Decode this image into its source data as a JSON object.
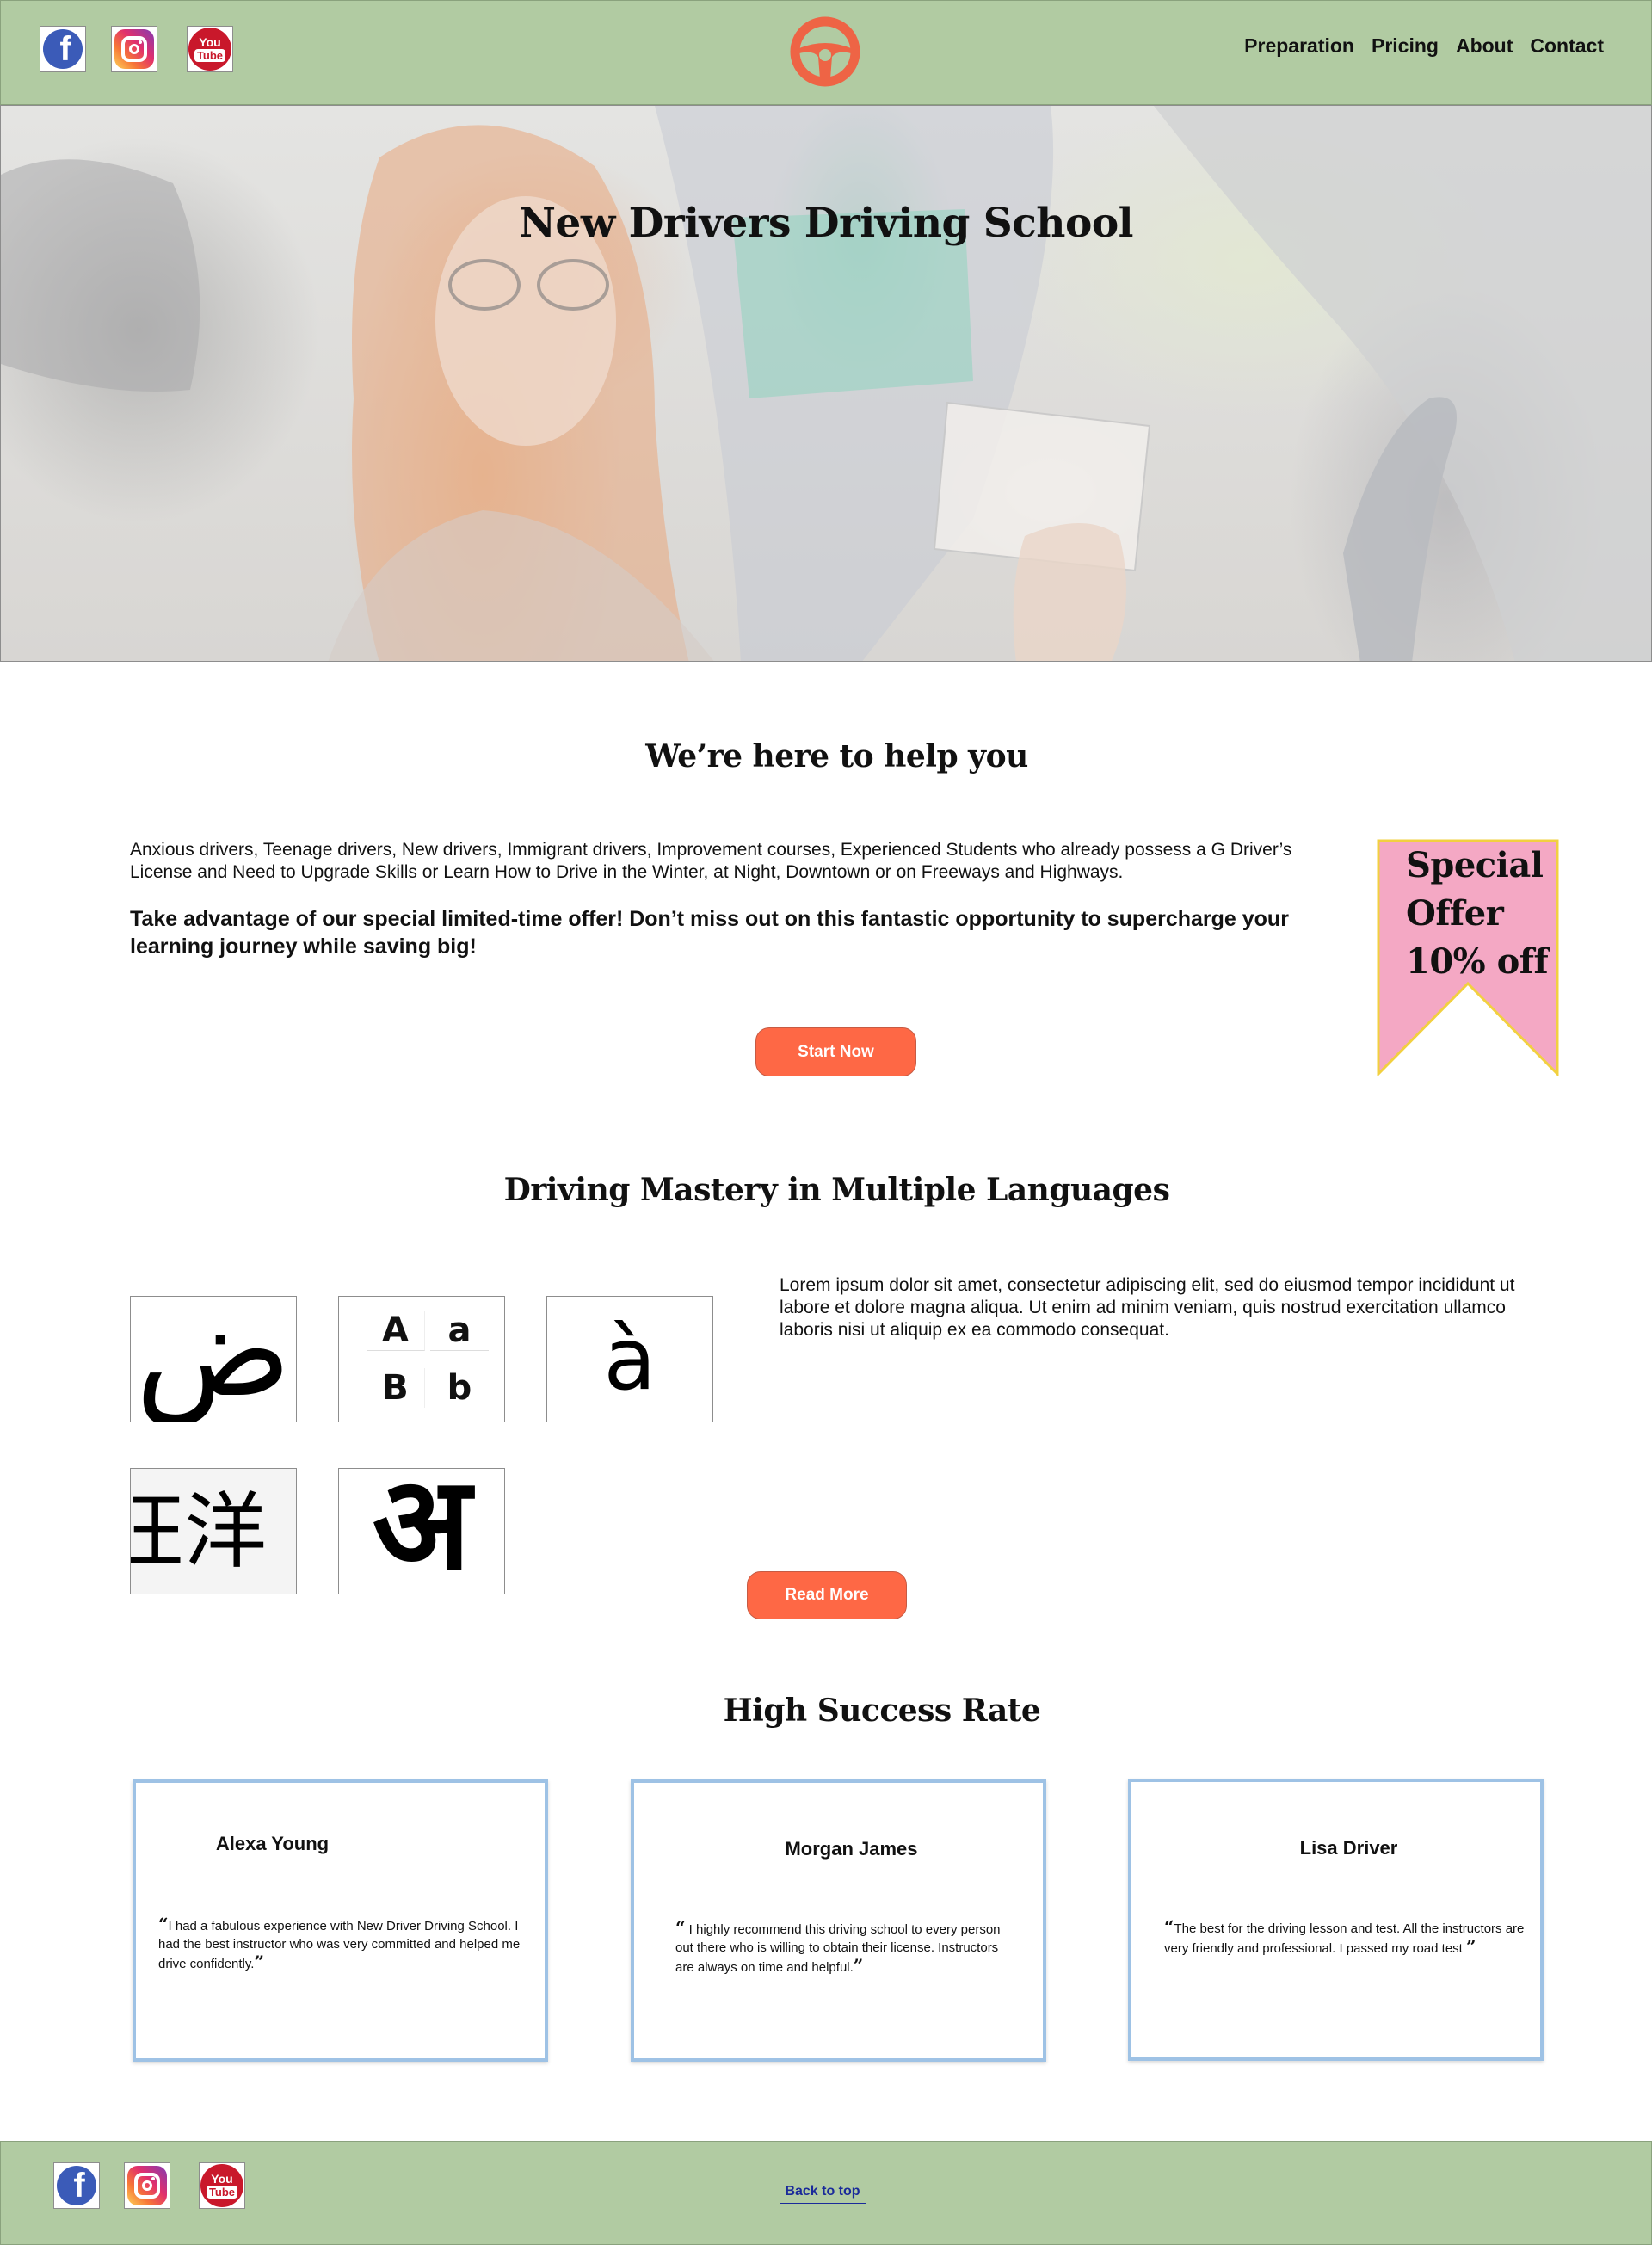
{
  "header": {
    "social": [
      "facebook-icon",
      "instagram-icon",
      "youtube-icon"
    ],
    "logo_icon": "steering-wheel-icon",
    "nav": [
      "Preparation",
      "Pricing",
      "About",
      "Contact"
    ]
  },
  "hero": {
    "title": "New Drivers Driving School"
  },
  "help": {
    "title": "We’re here to help you",
    "description": "Anxious drivers, Teenage drivers, New drivers, Immigrant drivers, Improvement courses, Experienced Students who already possess a G Driver’s License and Need to Upgrade Skills or Learn How to Drive in the Winter, at Night, Downtown or on Freeways and Highways.",
    "offer": "Take advantage of our special limited-time offer! Don’t miss out on this fantastic opportunity to supercharge your learning journey while saving big!",
    "button": "Start Now",
    "ribbon": [
      "Special",
      "Offer",
      "10% off"
    ]
  },
  "languages": {
    "title": "Driving Mastery in Multiple Languages",
    "tiles": [
      "ض",
      "A",
      "a",
      "B",
      "b",
      "à",
      "汪洋",
      "अ"
    ],
    "description": "Lorem ipsum dolor sit amet, consectetur adipiscing elit, sed do eiusmod tempor incididunt ut labore et dolore magna aliqua. Ut enim ad minim veniam, quis nostrud exercitation ullamco laboris nisi ut aliquip ex ea commodo consequat.",
    "button": "Read More"
  },
  "success": {
    "title": "High Success Rate",
    "testimonials": [
      {
        "name": "Alexa Young",
        "quote": "I had a fabulous experience with New Driver Driving School. I had the best instructor who was very committed and helped me drive confidently."
      },
      {
        "name": "Morgan James",
        "quote": " I highly recommend this driving school to every person out there who is willing to obtain their license. Instructors are always on time and helpful."
      },
      {
        "name": "Lisa Driver",
        "quote": "The best for the driving lesson and test. All the instructors are very friendly and professional. I passed my road test "
      }
    ]
  },
  "footer": {
    "social": [
      "facebook-icon",
      "instagram-icon",
      "youtube-icon"
    ],
    "back_to_top": "Back to top"
  },
  "colors": {
    "header_bg": "#b1cba2",
    "accent": "#fe6845",
    "ribbon_pink": "#f4a8c4",
    "ribbon_border": "#f2d040",
    "card_border": "#9ec2e5"
  }
}
